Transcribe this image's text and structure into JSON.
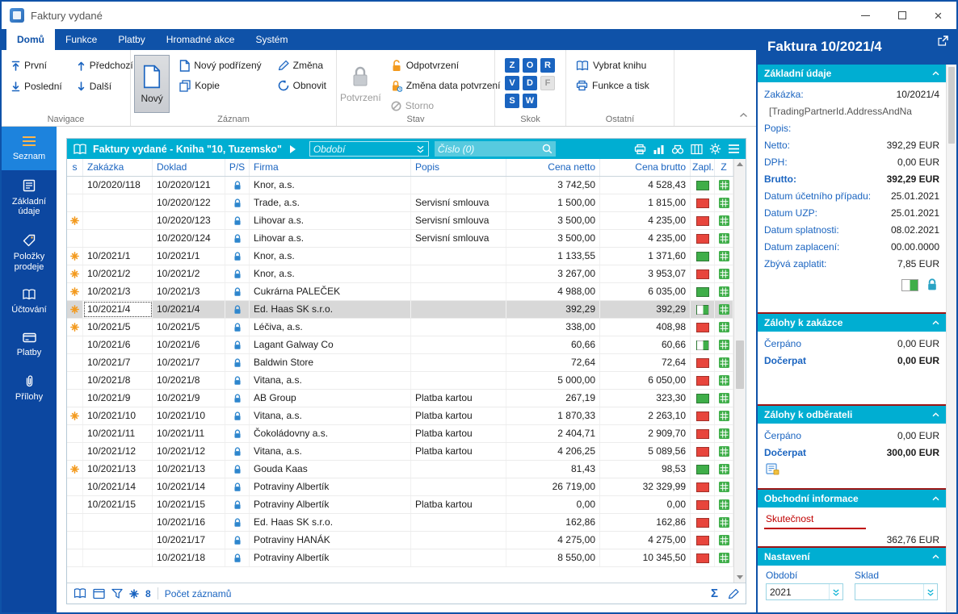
{
  "colors": {
    "dark_blue": "#0f52a8",
    "accent_blue": "#1a64c0",
    "teal": "#00aed2",
    "teal_light": "#57cadf",
    "sidebar_blue": "#0c47a0",
    "sidebar_active": "#1d83dd",
    "orange": "#f39a1e",
    "green": "#3fae49",
    "red": "#e8453c",
    "maroon": "#9b1515",
    "selected_row": "#d8d8d8"
  },
  "window": {
    "title": "Faktury vydané"
  },
  "ribbon": {
    "tabs": [
      {
        "id": "domu",
        "label": "Domů",
        "active": true
      },
      {
        "id": "funkce",
        "label": "Funkce",
        "active": false
      },
      {
        "id": "platby",
        "label": "Platby",
        "active": false
      },
      {
        "id": "hromadne-akce",
        "label": "Hromadné akce",
        "active": false
      },
      {
        "id": "system",
        "label": "Systém",
        "active": false
      }
    ],
    "navigace": {
      "label": "Navigace",
      "prvni": "První",
      "posledni": "Poslední",
      "predchozi": "Předchozí",
      "dalsi": "Další"
    },
    "zaznam": {
      "label": "Záznam",
      "novy": "Nový",
      "novy_podrizeny": "Nový podřízený",
      "kopie": "Kopie",
      "zmena": "Změna",
      "obnovit": "Obnovit"
    },
    "stav": {
      "label": "Stav",
      "potvrzeni": "Potvrzení",
      "odpotvrzeni": "Odpotvrzení",
      "zmena_data": "Změna data potvrzení",
      "storno": "Storno"
    },
    "skok": {
      "label": "Skok",
      "keys": [
        {
          "letter": "Z",
          "enabled": true
        },
        {
          "letter": "O",
          "enabled": true
        },
        {
          "letter": "R",
          "enabled": true
        },
        {
          "letter": "V",
          "enabled": true
        },
        {
          "letter": "D",
          "enabled": true
        },
        {
          "letter": "F",
          "enabled": false
        },
        {
          "letter": "S",
          "enabled": true
        },
        {
          "letter": "W",
          "enabled": true
        }
      ]
    },
    "ostatni": {
      "label": "Ostatní",
      "vybrat_knihu": "Vybrat knihu",
      "funkce_a_tisk": "Funkce a tisk"
    }
  },
  "sidebar": {
    "items": [
      {
        "label": "Seznam",
        "icon": "menu-icon",
        "active": true
      },
      {
        "label": "Základní údaje",
        "icon": "form-icon",
        "active": false
      },
      {
        "label": "Položky prodeje",
        "icon": "tag-icon",
        "active": false
      },
      {
        "label": "Účtování",
        "icon": "ledger-icon",
        "active": false
      },
      {
        "label": "Platby",
        "icon": "card-icon",
        "active": false
      },
      {
        "label": "Přílohy",
        "icon": "paperclip-icon",
        "active": false
      }
    ]
  },
  "list": {
    "title": "Faktury vydané - Kniha \"10, Tuzemsko\"",
    "period_placeholder": "Období",
    "search_placeholder": "Číslo (0)",
    "columns": {
      "s": "s",
      "zakazka": "Zakázka",
      "doklad": "Doklad",
      "ps": "P/S",
      "firma": "Firma",
      "popis": "Popis",
      "netto": "Cena netto",
      "brutto": "Cena brutto",
      "zapl": "Zapl.",
      "z": "Z"
    },
    "rows": [
      {
        "star": false,
        "zakazka": "10/2020/118",
        "doklad": "10/2020/121",
        "firma": "Knor, a.s.",
        "popis": "",
        "netto": "3 742,50",
        "brutto": "4 528,43",
        "zapl": "paid"
      },
      {
        "star": false,
        "zakazka": "",
        "doklad": "10/2020/122",
        "firma": "Trade, a.s.",
        "popis": "Servisní smlouva",
        "netto": "1 500,00",
        "brutto": "1 815,00",
        "zapl": "unpaid"
      },
      {
        "star": true,
        "zakazka": "",
        "doklad": "10/2020/123",
        "firma": "Lihovar a.s.",
        "popis": "Servisní smlouva",
        "netto": "3 500,00",
        "brutto": "4 235,00",
        "zapl": "unpaid"
      },
      {
        "star": false,
        "zakazka": "",
        "doklad": "10/2020/124",
        "firma": "Lihovar a.s.",
        "popis": "Servisní smlouva",
        "netto": "3 500,00",
        "brutto": "4 235,00",
        "zapl": "unpaid"
      },
      {
        "star": true,
        "zakazka": "10/2021/1",
        "doklad": "10/2021/1",
        "firma": "Knor, a.s.",
        "popis": "",
        "netto": "1 133,55",
        "brutto": "1 371,60",
        "zapl": "paid"
      },
      {
        "star": true,
        "zakazka": "10/2021/2",
        "doklad": "10/2021/2",
        "firma": "Knor, a.s.",
        "popis": "",
        "netto": "3 267,00",
        "brutto": "3 953,07",
        "zapl": "unpaid"
      },
      {
        "star": true,
        "zakazka": "10/2021/3",
        "doklad": "10/2021/3",
        "firma": "Cukrárna PALEČEK",
        "popis": "",
        "netto": "4 988,00",
        "brutto": "6 035,00",
        "zapl": "paid"
      },
      {
        "star": true,
        "zakazka": "10/2021/4",
        "doklad": "10/2021/4",
        "firma": "Ed. Haas SK s.r.o.",
        "popis": "",
        "netto": "392,29",
        "brutto": "392,29",
        "zapl": "partial",
        "selected": true
      },
      {
        "star": true,
        "zakazka": "10/2021/5",
        "doklad": "10/2021/5",
        "firma": "Léčiva, a.s.",
        "popis": "",
        "netto": "338,00",
        "brutto": "408,98",
        "zapl": "unpaid"
      },
      {
        "star": false,
        "zakazka": "10/2021/6",
        "doklad": "10/2021/6",
        "firma": "Lagant Galway Co",
        "popis": "",
        "netto": "60,66",
        "brutto": "60,66",
        "zapl": "partial"
      },
      {
        "star": false,
        "zakazka": "10/2021/7",
        "doklad": "10/2021/7",
        "firma": "Baldwin Store",
        "popis": "",
        "netto": "72,64",
        "brutto": "72,64",
        "zapl": "unpaid"
      },
      {
        "star": false,
        "zakazka": "10/2021/8",
        "doklad": "10/2021/8",
        "firma": "Vitana, a.s.",
        "popis": "",
        "netto": "5 000,00",
        "brutto": "6 050,00",
        "zapl": "unpaid"
      },
      {
        "star": false,
        "zakazka": "10/2021/9",
        "doklad": "10/2021/9",
        "firma": "AB Group",
        "popis": "Platba kartou",
        "netto": "267,19",
        "brutto": "323,30",
        "zapl": "paid"
      },
      {
        "star": true,
        "zakazka": "10/2021/10",
        "doklad": "10/2021/10",
        "firma": "Vitana, a.s.",
        "popis": "Platba kartou",
        "netto": "1 870,33",
        "brutto": "2 263,10",
        "zapl": "unpaid"
      },
      {
        "star": false,
        "zakazka": "10/2021/11",
        "doklad": "10/2021/11",
        "firma": "Čokoládovny a.s.",
        "popis": "Platba kartou",
        "netto": "2 404,71",
        "brutto": "2 909,70",
        "zapl": "unpaid"
      },
      {
        "star": false,
        "zakazka": "10/2021/12",
        "doklad": "10/2021/12",
        "firma": "Vitana, a.s.",
        "popis": "Platba kartou",
        "netto": "4 206,25",
        "brutto": "5 089,56",
        "zapl": "unpaid"
      },
      {
        "star": true,
        "zakazka": "10/2021/13",
        "doklad": "10/2021/13",
        "firma": "Gouda Kaas",
        "popis": "",
        "netto": "81,43",
        "brutto": "98,53",
        "zapl": "paid"
      },
      {
        "star": false,
        "zakazka": "10/2021/14",
        "doklad": "10/2021/14",
        "firma": "Potraviny Albertík",
        "popis": "",
        "netto": "26 719,00",
        "brutto": "32 329,99",
        "zapl": "unpaid"
      },
      {
        "star": false,
        "zakazka": "10/2021/15",
        "doklad": "10/2021/15",
        "firma": "Potraviny Albertík",
        "popis": "Platba kartou",
        "netto": "0,00",
        "brutto": "0,00",
        "zapl": "unpaid"
      },
      {
        "star": false,
        "zakazka": "",
        "doklad": "10/2021/16",
        "firma": "Ed. Haas SK s.r.o.",
        "popis": "",
        "netto": "162,86",
        "brutto": "162,86",
        "zapl": "unpaid"
      },
      {
        "star": false,
        "zakazka": "",
        "doklad": "10/2021/17",
        "firma": "Potraviny HANÁK",
        "popis": "",
        "netto": "4 275,00",
        "brutto": "4 275,00",
        "zapl": "unpaid"
      },
      {
        "star": false,
        "zakazka": "",
        "doklad": "10/2021/18",
        "firma": "Potraviny Albertík",
        "popis": "",
        "netto": "8 550,00",
        "brutto": "10 345,50",
        "zapl": "unpaid"
      }
    ],
    "footer": {
      "count": "8",
      "count_label": "Počet záznamů"
    }
  },
  "detail": {
    "title": "Faktura 10/2021/4",
    "sections": [
      {
        "title": "Základní údaje",
        "fields": [
          {
            "label": "Zakázka:",
            "value": "10/2021/4"
          },
          {
            "label": "",
            "value": "[TradingPartnerId.AddressAndNa",
            "muted": true
          },
          {
            "label": "Popis:",
            "value": ""
          },
          {
            "label": "Netto:",
            "value": "392,29 EUR"
          },
          {
            "label": "DPH:",
            "value": "0,00 EUR"
          },
          {
            "label": "Brutto:",
            "value": "392,29 EUR",
            "bold": true
          },
          {
            "label": "Datum účetního případu:",
            "value": "25.01.2021"
          },
          {
            "label": "Datum UZP:",
            "value": "25.01.2021"
          },
          {
            "label": "Datum splatnosti:",
            "value": "08.02.2021"
          },
          {
            "label": "Datum zaplacení:",
            "value": "00.00.0000"
          },
          {
            "label": "Zbývá zaplatit:",
            "value": "7,85 EUR"
          }
        ]
      },
      {
        "title": "Zálohy k zakázce",
        "fields": [
          {
            "label": "Čerpáno",
            "value": "0,00 EUR"
          },
          {
            "label": "Dočerpat",
            "value": "0,00 EUR",
            "bold": true
          }
        ]
      },
      {
        "title": "Zálohy k odběrateli",
        "fields": [
          {
            "label": "Čerpáno",
            "value": "0,00 EUR"
          },
          {
            "label": "Dočerpat",
            "value": "300,00 EUR",
            "bold": true
          }
        ]
      },
      {
        "title": "Obchodní informace",
        "tab": "Skutečnost",
        "fields": [
          {
            "label": "",
            "value": "362,76 EUR"
          }
        ]
      }
    ],
    "nastaveni": {
      "title": "Nastavení",
      "obdobi_label": "Období",
      "obdobi_value": "2021",
      "sklad_label": "Sklad",
      "sklad_value": ""
    }
  }
}
